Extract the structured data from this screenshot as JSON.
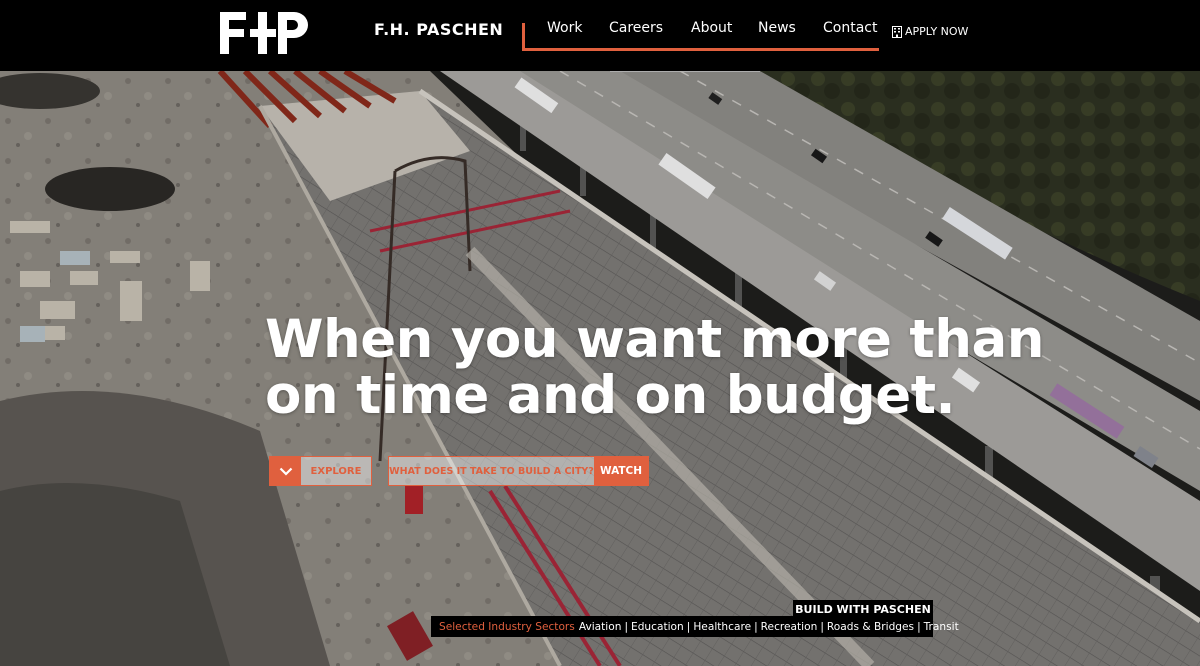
{
  "header": {
    "logo_text": "FHP",
    "brand_name": "F.H. PASCHEN",
    "nav": [
      {
        "label": "Work"
      },
      {
        "label": "Careers"
      },
      {
        "label": "About"
      },
      {
        "label": "News"
      },
      {
        "label": "Contact"
      }
    ],
    "apply": {
      "icon": "building-icon",
      "label": "APPLY NOW"
    }
  },
  "hero": {
    "headline_line1": "When you want more than",
    "headline_line2": "on time and on budget.",
    "explore": {
      "icon": "chevron-down-icon",
      "label": "EXPLORE"
    },
    "video": {
      "question": "WHAT DOES IT TAKE TO BUILD A CITY?",
      "label": "WATCH"
    },
    "build_tag": "BUILD WITH PASCHEN",
    "sectors": {
      "label": "Selected Industry Sectors",
      "items": [
        "Aviation",
        "Education",
        "Healthcare",
        "Recreation",
        "Roads & Bridges",
        "Transit"
      ]
    }
  },
  "colors": {
    "accent": "#e0603e",
    "header_bg": "#000000",
    "text": "#ffffff"
  }
}
